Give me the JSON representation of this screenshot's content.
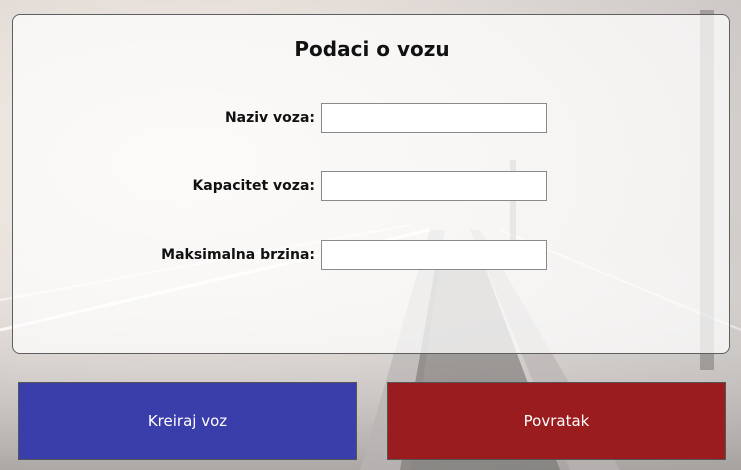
{
  "form": {
    "title": "Podaci o vozu",
    "fields": [
      {
        "label": "Naziv voza:",
        "value": ""
      },
      {
        "label": "Kapacitet voza:",
        "value": ""
      },
      {
        "label": "Maksimalna brzina:",
        "value": ""
      }
    ]
  },
  "buttons": {
    "create_label": "Kreiraj voz",
    "back_label": "Povratak"
  },
  "colors": {
    "create_button": "#3a3eaa",
    "back_button": "#9b1c1f"
  }
}
